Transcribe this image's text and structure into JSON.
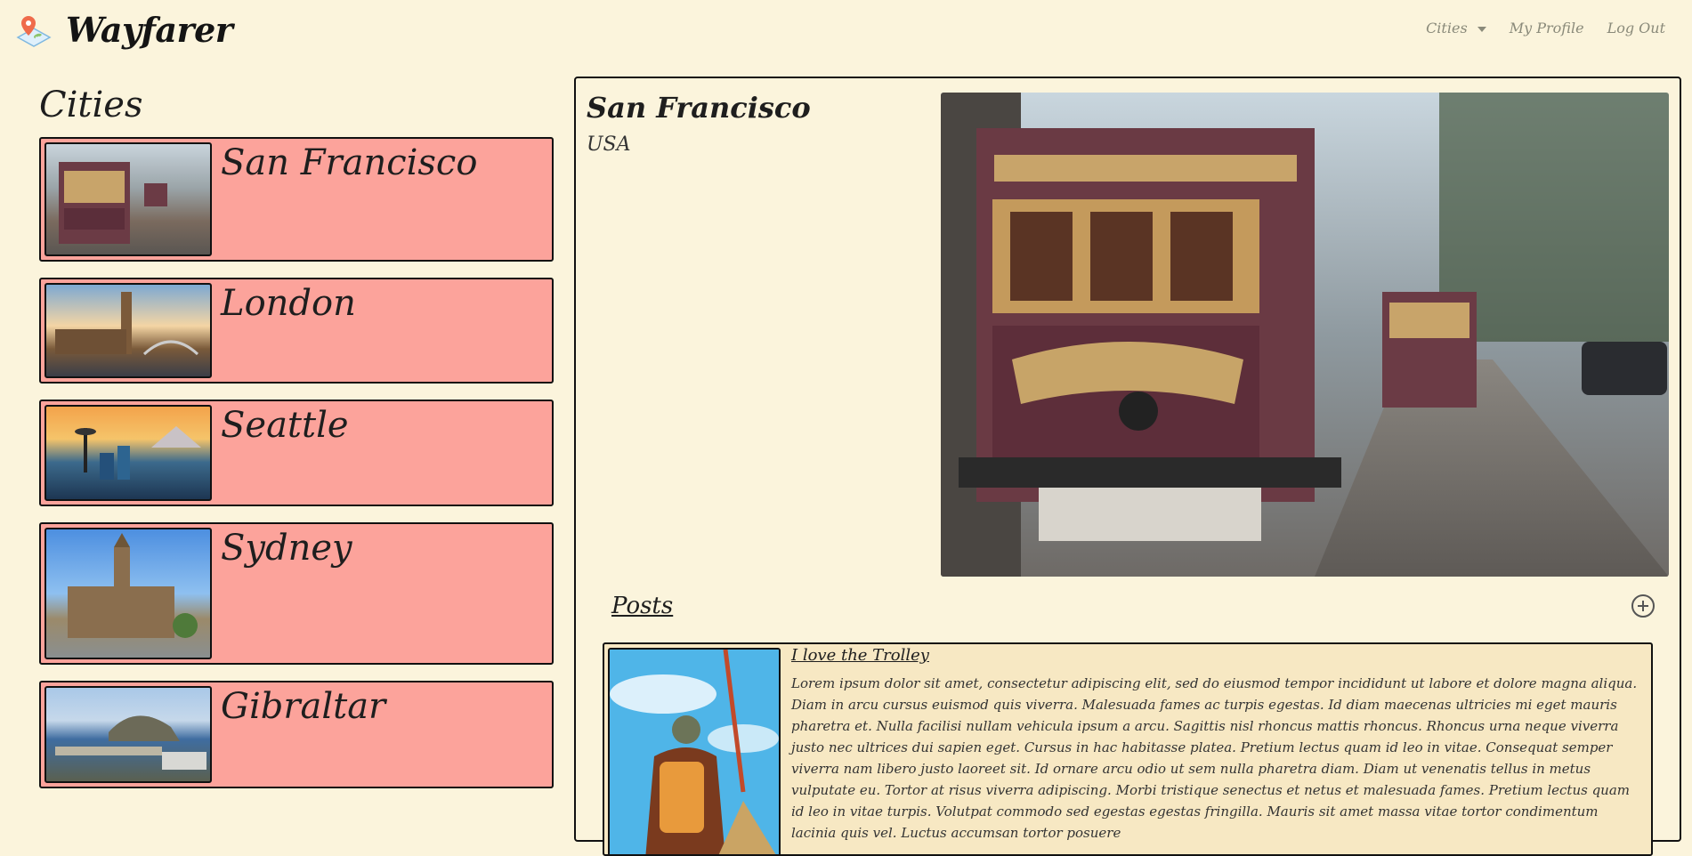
{
  "app": {
    "title": "Wayfarer"
  },
  "nav": {
    "cities": "Cities",
    "profile": "My Profile",
    "logout": "Log Out"
  },
  "sidebar": {
    "title": "Cities",
    "cities": [
      {
        "name": "San Francisco"
      },
      {
        "name": "London"
      },
      {
        "name": "Seattle"
      },
      {
        "name": "Sydney"
      },
      {
        "name": "Gibraltar"
      }
    ]
  },
  "detail": {
    "name": "San Francisco",
    "country": "USA",
    "posts_title": "Posts",
    "posts": [
      {
        "title": "I love the Trolley",
        "body": "Lorem ipsum dolor sit amet, consectetur adipiscing elit, sed do eiusmod tempor incididunt ut labore et dolore magna aliqua. Diam in arcu cursus euismod quis viverra. Malesuada fames ac turpis egestas. Id diam maecenas ultricies mi eget mauris pharetra et. Nulla facilisi nullam vehicula ipsum a arcu. Sagittis nisl rhoncus mattis rhoncus. Rhoncus urna neque viverra justo nec ultrices dui sapien eget. Cursus in hac habitasse platea. Pretium lectus quam id leo in vitae. Consequat semper viverra nam libero justo laoreet sit. Id ornare arcu odio ut sem nulla pharetra diam. Diam ut venenatis tellus in metus vulputate eu. Tortor at risus viverra adipiscing. Morbi tristique senectus et netus et malesuada fames. Pretium lectus quam id leo in vitae turpis. Volutpat commodo sed egestas egestas fringilla. Mauris sit amet massa vitae tortor condimentum lacinia quis vel. Luctus accumsan tortor posuere"
      }
    ]
  }
}
